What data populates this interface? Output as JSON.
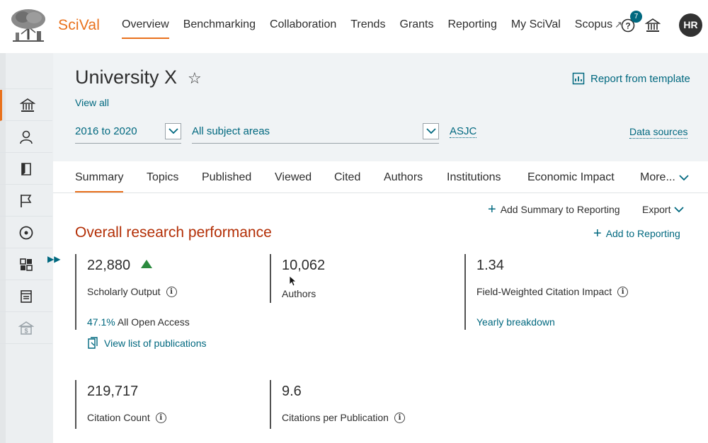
{
  "nav": {
    "brand": "SciVal",
    "items": [
      "Overview",
      "Benchmarking",
      "Collaboration",
      "Trends",
      "Grants",
      "Reporting",
      "My SciVal",
      "Scopus"
    ],
    "scopus_ext_icon": "↗",
    "help_icon": "?",
    "notification_count": "7",
    "avatar_initials": "HR"
  },
  "sidebar": {
    "items": [
      "institution-icon",
      "researcher-icon",
      "publication-set-icon",
      "country-icon",
      "topic-icon",
      "group-icon",
      "journal-icon",
      "funding-icon"
    ]
  },
  "header": {
    "title": "University X",
    "star": "☆",
    "view_all": "View all",
    "report_from_template": "Report from template",
    "year_range": "2016 to 2020",
    "subject_areas": "All subject areas",
    "asjc": "ASJC",
    "data_sources": "Data sources"
  },
  "tabs": [
    "Summary",
    "Topics",
    "Published",
    "Viewed",
    "Cited",
    "Authors",
    "Institutions",
    "Economic Impact",
    "More..."
  ],
  "toolbar": {
    "add_summary": "Add Summary to Reporting",
    "export": "Export"
  },
  "section": {
    "title": "Overall research performance",
    "add_to_reporting": "Add to Reporting"
  },
  "metrics": {
    "scholarly_output": {
      "value": "22,880",
      "label": "Scholarly Output"
    },
    "authors": {
      "value": "10,062",
      "label": "Authors"
    },
    "fwci": {
      "value": "1.34",
      "label": "Field-Weighted Citation Impact"
    },
    "citation_count": {
      "value": "219,717",
      "label": "Citation Count"
    },
    "citations_per_pub": {
      "value": "9.6",
      "label": "Citations per Publication"
    }
  },
  "open_access": {
    "pct": "47.1%",
    "label": "All Open Access"
  },
  "view_list": "View list of publications",
  "yearly_breakdown": "Yearly breakdown",
  "colors": {
    "accent": "#e9711c",
    "link": "#00687f",
    "section_title": "#b32e05",
    "trend_up": "#2b8a3e"
  }
}
